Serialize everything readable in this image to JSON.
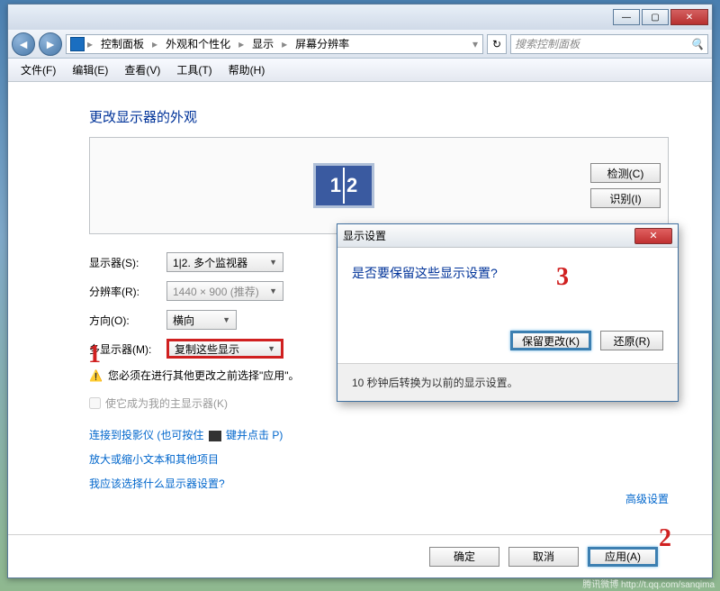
{
  "breadcrumb": {
    "root": "控制面板",
    "l2": "外观和个性化",
    "l3": "显示",
    "l4": "屏幕分辨率"
  },
  "search": {
    "placeholder": "搜索控制面板"
  },
  "menu": {
    "file": "文件(F)",
    "edit": "编辑(E)",
    "view": "查看(V)",
    "tools": "工具(T)",
    "help": "帮助(H)"
  },
  "page": {
    "title": "更改显示器的外观",
    "detect": "检测(C)",
    "identify": "识别(I)",
    "display_label": "显示器(S):",
    "display_value": "1|2. 多个监视器",
    "resolution_label": "分辨率(R):",
    "resolution_value": "1440 × 900 (推荐)",
    "orientation_label": "方向(O):",
    "orientation_value": "横向",
    "multi_label": "多显示器(M):",
    "multi_value": "复制这些显示",
    "warn": "您必须在进行其他更改之前选择\"应用\"。",
    "main_cb": "使它成为我的主显示器(K)",
    "link1": "连接到投影仪 (也可按住 ",
    "link1b": " 键并点击 P)",
    "link2": "放大或缩小文本和其他项目",
    "link3": "我应该选择什么显示器设置?",
    "advanced": "高级设置",
    "ok": "确定",
    "cancel": "取消",
    "apply": "应用(A)"
  },
  "dialog": {
    "title": "显示设置",
    "question": "是否要保留这些显示设置?",
    "keep": "保留更改(K)",
    "revert": "还原(R)",
    "countdown": "10 秒钟后转换为以前的显示设置。"
  },
  "watermark": "腾讯微博  http://t.qq.com/sanqima"
}
